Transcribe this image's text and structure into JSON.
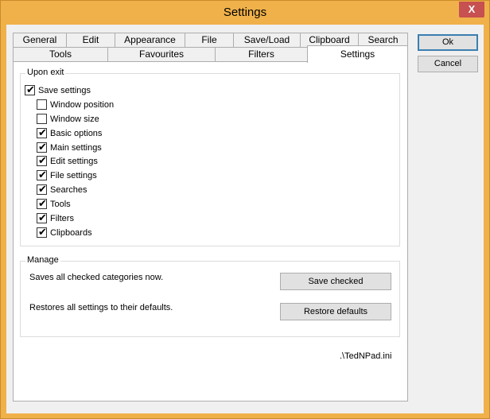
{
  "window": {
    "title": "Settings",
    "close_label": "X"
  },
  "tabs_top": [
    "General",
    "Edit",
    "Appearance",
    "File",
    "Save/Load",
    "Clipboard",
    "Search"
  ],
  "tabs_bottom": [
    "Tools",
    "Favourites",
    "Filters",
    "Settings"
  ],
  "active_tab": "Settings",
  "buttons": {
    "ok": "Ok",
    "cancel": "Cancel"
  },
  "upon_exit": {
    "title": "Upon exit",
    "save_settings": {
      "label": "Save settings",
      "checked": true
    },
    "items": [
      {
        "label": "Window position",
        "checked": false
      },
      {
        "label": "Window size",
        "checked": false
      },
      {
        "label": "Basic options",
        "checked": true
      },
      {
        "label": "Main settings",
        "checked": true
      },
      {
        "label": "Edit settings",
        "checked": true
      },
      {
        "label": "File settings",
        "checked": true
      },
      {
        "label": "Searches",
        "checked": true
      },
      {
        "label": "Tools",
        "checked": true
      },
      {
        "label": "Filters",
        "checked": true
      },
      {
        "label": "Clipboards",
        "checked": true
      }
    ]
  },
  "manage": {
    "title": "Manage",
    "save_desc": "Saves all checked categories now.",
    "save_button": "Save checked",
    "restore_desc": "Restores all settings to their defaults.",
    "restore_button": "Restore defaults"
  },
  "ini_path": ".\\TedNPad.ini",
  "check_mark": "✔"
}
